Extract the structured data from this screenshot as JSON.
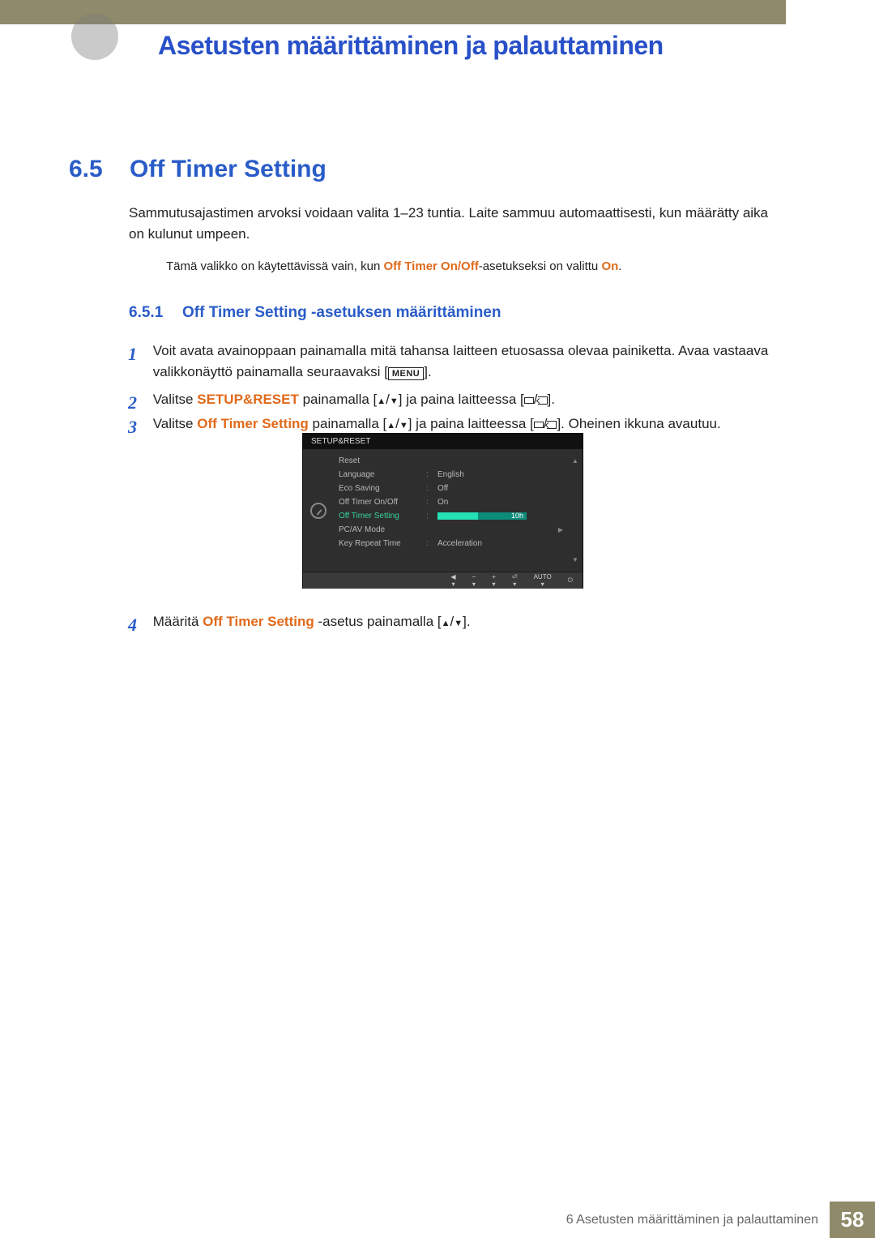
{
  "chapter": {
    "title": "Asetusten määrittäminen ja palauttaminen"
  },
  "section": {
    "number": "6.5",
    "title": "Off Timer Setting"
  },
  "intro": "Sammutusajastimen arvoksi voidaan valita 1–23 tuntia. Laite sammuu automaattisesti, kun määrätty aika on kulunut umpeen.",
  "note": {
    "pre": "Tämä valikko on käytettävissä vain, kun ",
    "bold": "Off Timer On/Off",
    "mid": "-asetukseksi on valittu ",
    "bold2": "On",
    "post": "."
  },
  "subsection": {
    "number": "6.5.1",
    "title": "Off Timer Setting -asetuksen määrittäminen"
  },
  "steps": {
    "s1": {
      "num": "1",
      "line1": "Voit avata avainoppaan painamalla mitä tahansa laitteen etuosassa olevaa painiketta. Avaa vastaava valikkonäyttö painamalla seuraavaksi [",
      "menu": "MENU",
      "line1_end": "]."
    },
    "s2": {
      "num": "2",
      "pre": "Valitse ",
      "bold": "SETUP&RESET",
      "mid": " painamalla [",
      "mid2": "] ja paina laitteessa [",
      "end": "]."
    },
    "s3": {
      "num": "3",
      "pre": "Valitse ",
      "bold": "Off Timer Setting",
      "mid": " painamalla [",
      "mid2": "] ja paina laitteessa [",
      "mid3": "]. Oheinen ikkuna avautuu."
    },
    "s4": {
      "num": "4",
      "pre": "Määritä ",
      "bold": "Off Timer Setting",
      "mid": " -asetus painamalla [",
      "end": "]."
    }
  },
  "osd": {
    "header": "SETUP&RESET",
    "rows": [
      {
        "label": "Reset",
        "val": ""
      },
      {
        "label": "Language",
        "val": "English"
      },
      {
        "label": "Eco Saving",
        "val": "Off"
      },
      {
        "label": "Off Timer On/Off",
        "val": "On"
      },
      {
        "label": "Off Timer Setting",
        "val": "10h",
        "highlight": true,
        "slider": true
      },
      {
        "label": "PC/AV Mode",
        "val": ""
      },
      {
        "label": "Key Repeat Time",
        "val": "Acceleration"
      }
    ],
    "footer_auto": "AUTO"
  },
  "footer": {
    "chapter_label": "6 Asetusten määrittäminen ja palauttaminen",
    "page": "58"
  },
  "chart_data": {
    "type": "table",
    "title": "SETUP&RESET OSD menu",
    "rows": [
      [
        "Reset",
        ""
      ],
      [
        "Language",
        "English"
      ],
      [
        "Eco Saving",
        "Off"
      ],
      [
        "Off Timer On/Off",
        "On"
      ],
      [
        "Off Timer Setting",
        "10h"
      ],
      [
        "PC/AV Mode",
        ""
      ],
      [
        "Key Repeat Time",
        "Acceleration"
      ]
    ]
  }
}
